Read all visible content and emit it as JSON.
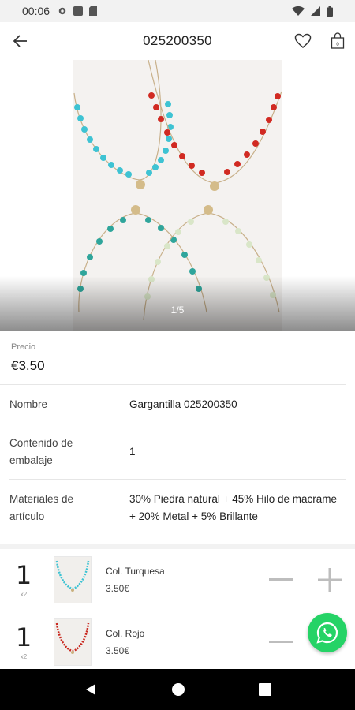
{
  "status_bar": {
    "time": "00:06"
  },
  "app_bar": {
    "title": "025200350"
  },
  "gallery": {
    "counter": "1/5"
  },
  "details": {
    "price_label": "Precio",
    "price_value": "€3.50",
    "rows": [
      {
        "label": "Nombre",
        "value": "Gargantilla 025200350"
      },
      {
        "label": "Contenido de embalaje",
        "value": "1"
      },
      {
        "label": "Materiales de artículo",
        "value": "30% Piedra natural + 45% Hilo de macrame + 20% Metal + 5% Brillante"
      }
    ]
  },
  "variants": [
    {
      "quantity": "1",
      "multiplier": "x2",
      "name": "Col. Turquesa",
      "price": "3.50€",
      "color": "#3fb7c4"
    },
    {
      "quantity": "1",
      "multiplier": "x2",
      "name": "Col. Rojo",
      "price": "3.50€",
      "color": "#c9281f"
    }
  ],
  "colors": {
    "whatsapp": "#25d366",
    "turquoise": "#3fc0d0",
    "red": "#d12a22"
  }
}
